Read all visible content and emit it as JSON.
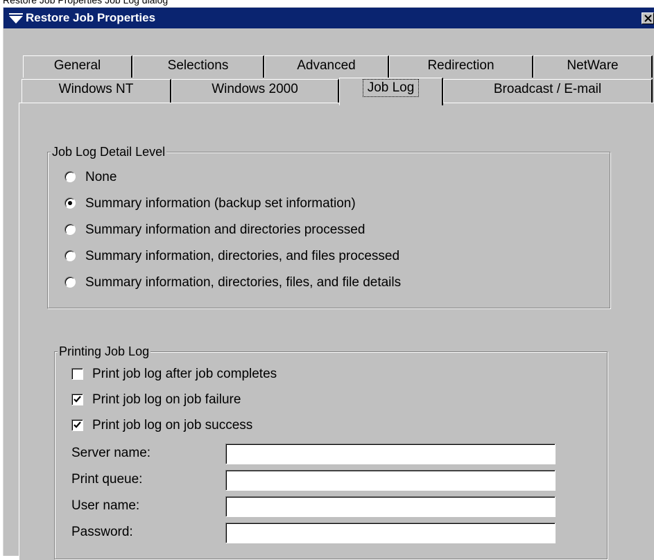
{
  "caption": "Restore Job Properties Job Log dialog",
  "window": {
    "title": "Restore Job Properties",
    "close_symbol": "✕"
  },
  "tabs": {
    "row1": [
      {
        "label": "General"
      },
      {
        "label": "Selections"
      },
      {
        "label": "Advanced"
      },
      {
        "label": "Redirection"
      },
      {
        "label": "NetWare"
      }
    ],
    "row2": [
      {
        "label": "Windows NT"
      },
      {
        "label": "Windows 2000"
      },
      {
        "label": "Job Log",
        "active": true
      },
      {
        "label": "Broadcast / E-mail"
      }
    ]
  },
  "detail_level": {
    "title": "Job Log Detail Level",
    "selected_index": 1,
    "options": [
      {
        "label": "None",
        "selected": false
      },
      {
        "label": "Summary information (backup set information)",
        "selected": true
      },
      {
        "label": "Summary information and directories processed",
        "selected": false
      },
      {
        "label": "Summary information, directories, and files processed",
        "selected": false
      },
      {
        "label": "Summary information, directories, files, and file details",
        "selected": false
      }
    ]
  },
  "printing": {
    "title": "Printing Job Log",
    "checkboxes": [
      {
        "label": "Print job log after job completes",
        "checked": false
      },
      {
        "label": "Print job log on job failure",
        "checked": true
      },
      {
        "label": "Print job log on job success",
        "checked": true
      }
    ],
    "fields": [
      {
        "label": "Server name:",
        "value": ""
      },
      {
        "label": "Print queue:",
        "value": ""
      },
      {
        "label": "User name:",
        "value": ""
      },
      {
        "label": "Password:",
        "value": ""
      }
    ]
  },
  "icons": {
    "title": "down-triangle-menu-icon",
    "close": "close-icon",
    "check": "checkmark-icon"
  },
  "colors": {
    "titlebar": "#0a2470",
    "face": "#c0c0c0"
  }
}
